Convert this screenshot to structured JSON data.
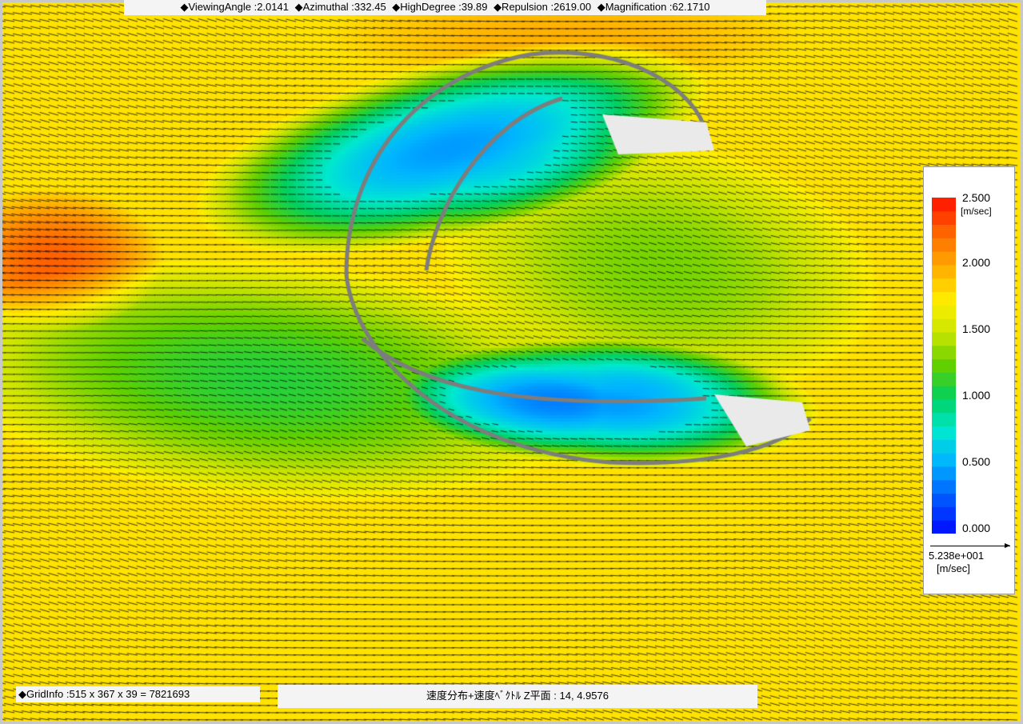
{
  "header_info": {
    "viewing_angle": "◆ViewingAngle :2.0141",
    "azimuthal": "◆Azimuthal :332.45",
    "high_degree": "◆HighDegree :39.89",
    "repulsion": "◆Repulsion :2619.00",
    "magnification": "◆Magnification :62.1710"
  },
  "grid_info": "◆GridInfo :515 x 367 x 39 = 7821693",
  "plane_info": "速度分布+速度ﾍﾞｸﾄﾙ Z平面 : 14,  4.9576",
  "legend": {
    "max_label": "2.500",
    "unit": "[m/sec]",
    "ticks": [
      "2.000",
      "1.500",
      "1.000",
      "0.500",
      "0.000"
    ],
    "vector_reference_value": "5.238e+001",
    "vector_reference_unit": "[m/sec]",
    "colors": [
      "#0018ff",
      "#0060ff",
      "#00b4ff",
      "#00e8d0",
      "#00d060",
      "#60d000",
      "#c8e400",
      "#ffee00",
      "#ffb000",
      "#ff7000",
      "#ff2000"
    ]
  }
}
